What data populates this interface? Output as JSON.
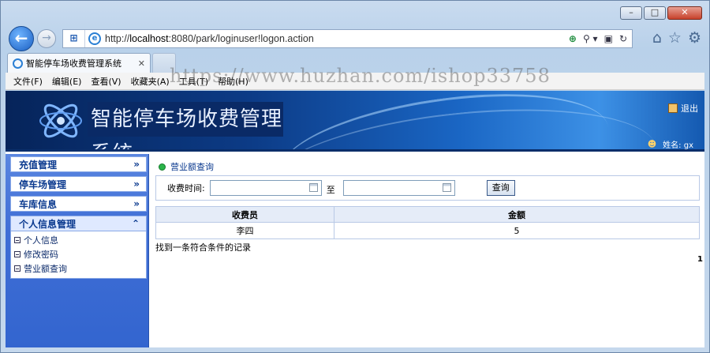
{
  "browser": {
    "url_prefix": "http://",
    "url_host": "localhost",
    "url_rest": ":8080/park/loginuser!logon.action",
    "tab_title": "智能停车场收费管理系统",
    "menu": [
      "文件(F)",
      "编辑(E)",
      "查看(V)",
      "收藏夹(A)",
      "工具(T)",
      "帮助(H)"
    ],
    "watermark": "https://www.huzhan.com/ishop33758"
  },
  "header": {
    "title": "智能停车场收费管理系统",
    "logout": "退出",
    "user_label": "姓名: gx"
  },
  "sidebar": {
    "items": [
      {
        "label": "充值管理",
        "arrow": "»"
      },
      {
        "label": "停车场管理",
        "arrow": "»"
      },
      {
        "label": "车库信息",
        "arrow": "»"
      },
      {
        "label": "个人信息管理",
        "arrow": "⌃"
      }
    ],
    "subitems": [
      "个人信息",
      "修改密码",
      "营业额查询"
    ]
  },
  "main": {
    "breadcrumb": "营业额查询",
    "search": {
      "label": "收费时间:",
      "from_value": "",
      "to_label": "至",
      "to_value": "",
      "button": "查询"
    },
    "table": {
      "headers": [
        "收费员",
        "金额"
      ],
      "rows": [
        [
          "李四",
          "5"
        ]
      ]
    },
    "result_text": "找到一条符合条件的记录",
    "page": "1"
  }
}
